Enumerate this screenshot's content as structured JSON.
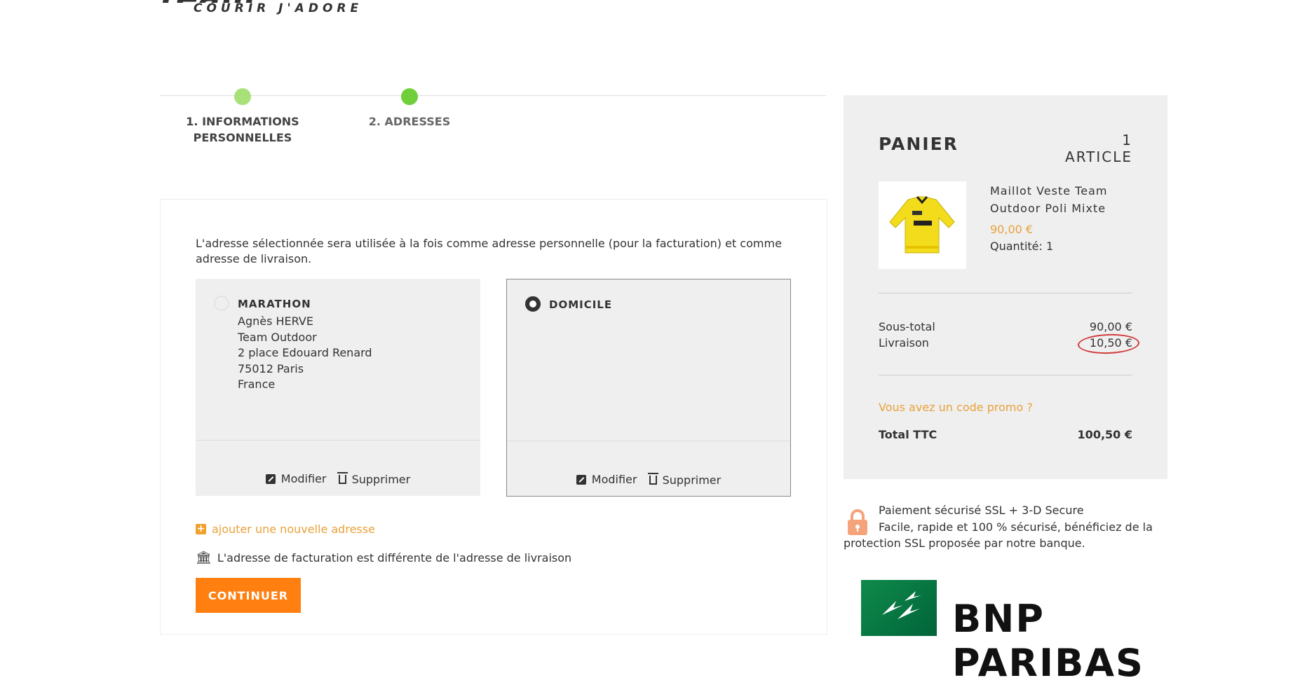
{
  "brand": {
    "logo_main_left": "team ",
    "logo_main_o": "o",
    "logo_main_right": "utdoor",
    "tagline": "COURIR J'ADORE"
  },
  "steps": [
    {
      "label": "1. INFORMATIONS PERSONNELLES"
    },
    {
      "label": "2. ADRESSES"
    }
  ],
  "addresses": {
    "intro": "L'adresse sélectionnée sera utilisée à la fois comme adresse personnelle (pour la facturation) et comme adresse de livraison.",
    "items": [
      {
        "title": "MARATHON",
        "lines": [
          "Agnès HERVE",
          "Team Outdoor",
          "2 place Edouard Renard",
          "75012 Paris",
          "France"
        ],
        "edit_label": "Modifier",
        "delete_label": "Supprimer"
      },
      {
        "title": "DOMICILE",
        "lines": [],
        "edit_label": "Modifier",
        "delete_label": "Supprimer"
      }
    ],
    "add_new_label": "ajouter une nouvelle adresse",
    "billing_different_label": "L'adresse de facturation est différente de l'adresse de livraison",
    "continue_label": "CONTINUER"
  },
  "cart": {
    "title": "PANIER",
    "count": "1 ARTICLE",
    "product": {
      "name": "Maillot Veste Team Outdoor Poli Mixte",
      "price": "90,00 €",
      "quantity": "Quantité: 1"
    },
    "subtotal_label": "Sous-total",
    "subtotal_value": "90,00 €",
    "shipping_label": "Livraison",
    "shipping_value": "10,50 €",
    "promo_label": "Vous avez un code promo ?",
    "total_label": "Total TTC",
    "total_value": "100,50 €"
  },
  "secure": {
    "title": "Paiement sécurisé SSL + 3-D Secure",
    "text": "Facile, rapide et 100 % sécurisé, bénéficiez de la protection SSL proposée par notre banque.",
    "bank_name": "BNP PARIBAS"
  },
  "colors": {
    "accent": "#ff7f11",
    "link": "#e8a23a",
    "step_done": "#a8e07a",
    "step_active": "#6fcf3b"
  }
}
